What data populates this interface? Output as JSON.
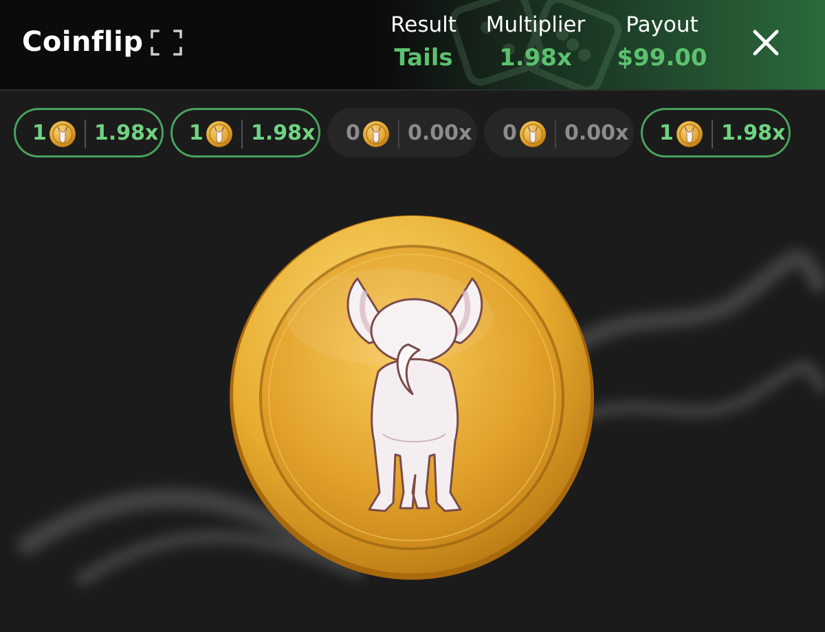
{
  "header": {
    "title": "Coinflip",
    "result": {
      "label": "Result",
      "value": "Tails"
    },
    "multiplier": {
      "label": "Multiplier",
      "value": "1.98x"
    },
    "payout": {
      "label": "Payout",
      "value": "$99.00"
    }
  },
  "history": [
    {
      "count": "1",
      "multiplier": "1.98x",
      "won": true
    },
    {
      "count": "1",
      "multiplier": "1.98x",
      "won": true
    },
    {
      "count": "0",
      "multiplier": "0.00x",
      "won": false
    },
    {
      "count": "0",
      "multiplier": "0.00x",
      "won": false
    },
    {
      "count": "1",
      "multiplier": "1.98x",
      "won": true
    }
  ],
  "coin": {
    "face": "tails",
    "art": "chihuahua-back-icon"
  },
  "colors": {
    "accent_green": "#5cc16f",
    "coin_gold": "#e0a52a",
    "background": "#1b1b1b"
  }
}
